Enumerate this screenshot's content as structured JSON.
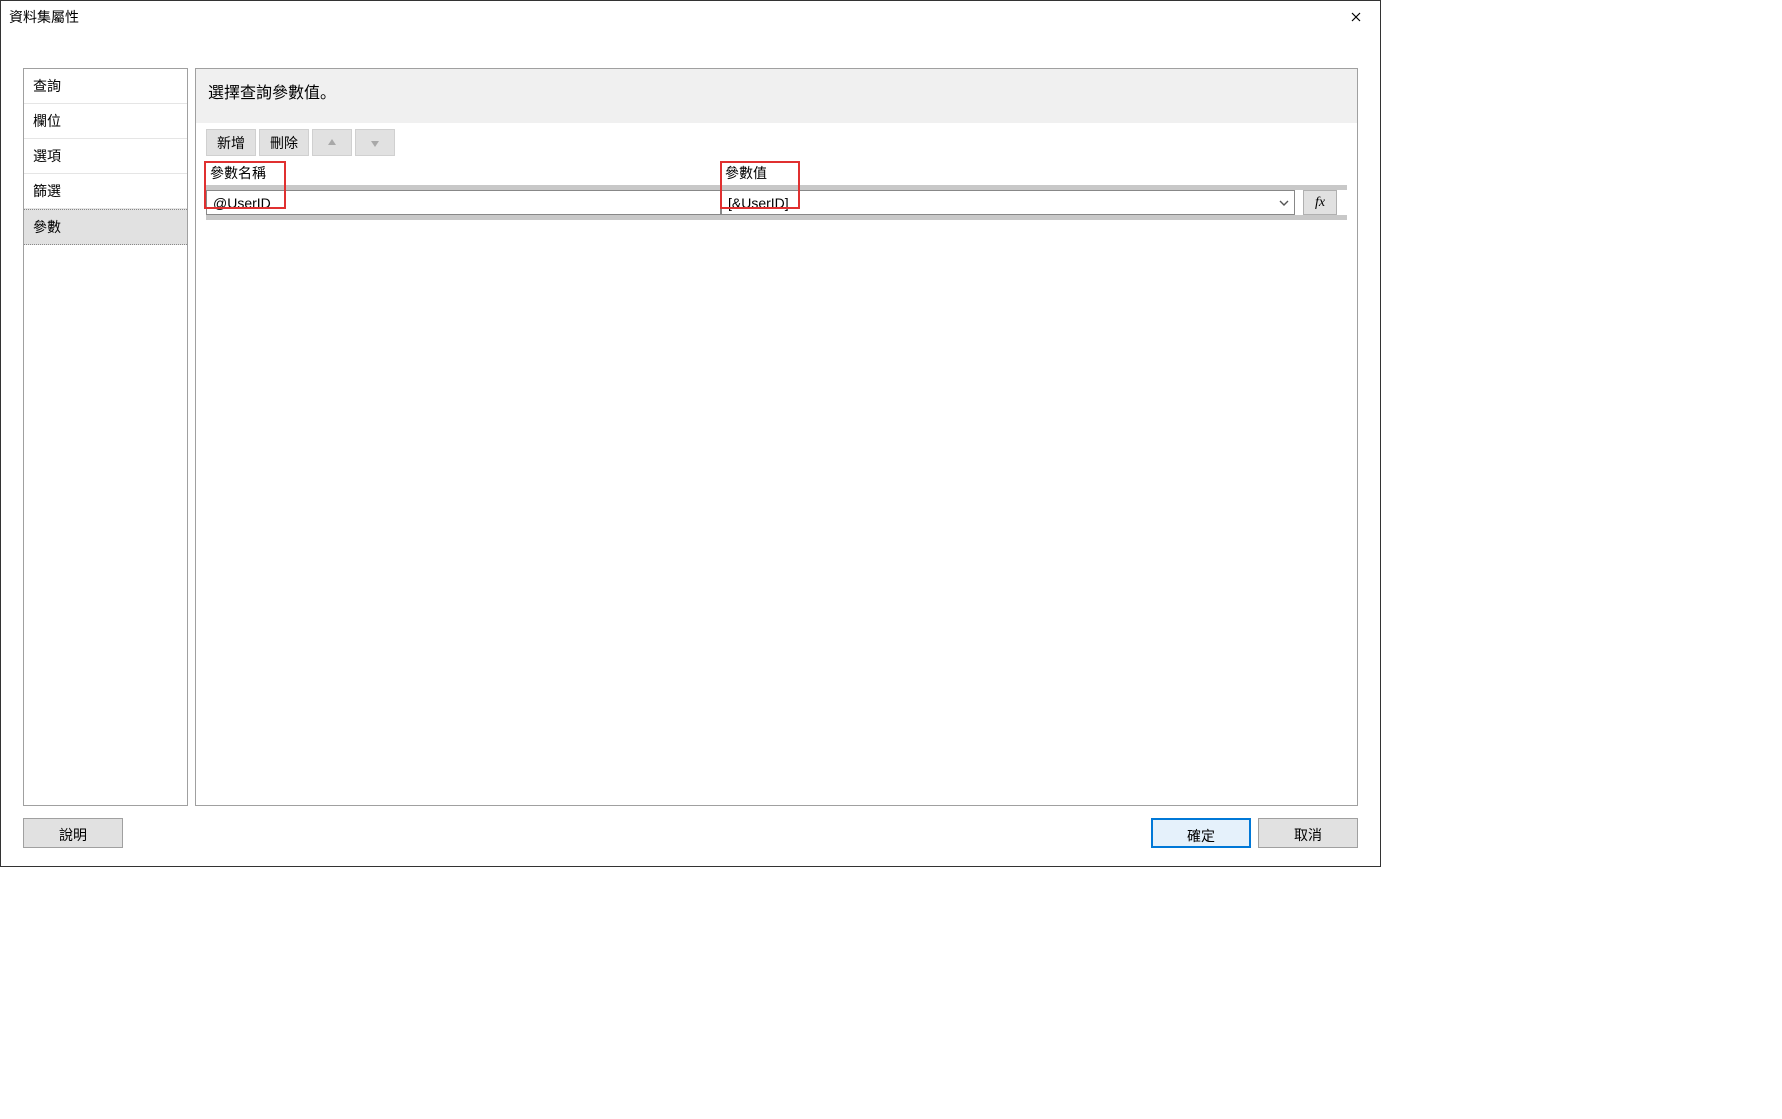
{
  "dialog": {
    "title": "資料集屬性"
  },
  "sidebar": {
    "items": [
      {
        "label": "查詢"
      },
      {
        "label": "欄位"
      },
      {
        "label": "選項"
      },
      {
        "label": "篩選"
      },
      {
        "label": "參數"
      }
    ]
  },
  "main": {
    "instruction": "選擇查詢參數值。",
    "toolbar": {
      "add": "新增",
      "delete": "刪除"
    },
    "grid": {
      "columns": {
        "name": "參數名稱",
        "value": "參數值"
      },
      "rows": [
        {
          "name": "@UserID",
          "value": "[&UserID]"
        }
      ]
    },
    "fx": "fx"
  },
  "footer": {
    "help": "說明",
    "ok": "確定",
    "cancel": "取消"
  }
}
